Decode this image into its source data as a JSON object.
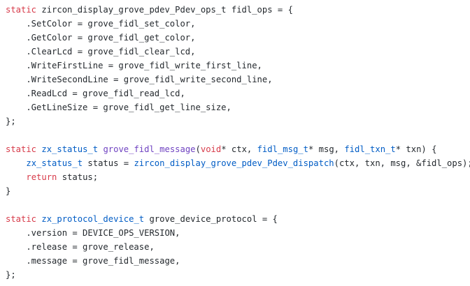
{
  "editor": {
    "colors": {
      "keyword": "#d73a49",
      "type": "#005cc5",
      "function": "#6f42c1",
      "text": "#24292e",
      "background": "#ffffff"
    },
    "lines": [
      [
        {
          "t": "static",
          "c": "kw"
        },
        {
          "t": " zircon_display_grove_pdev_Pdev_ops_t fidl_ops = {",
          "c": "plain"
        }
      ],
      [
        {
          "t": "    .SetColor = grove_fidl_set_color,",
          "c": "plain"
        }
      ],
      [
        {
          "t": "    .GetColor = grove_fidl_get_color,",
          "c": "plain"
        }
      ],
      [
        {
          "t": "    .ClearLcd = grove_fidl_clear_lcd,",
          "c": "plain"
        }
      ],
      [
        {
          "t": "    .WriteFirstLine = grove_fidl_write_first_line,",
          "c": "plain"
        }
      ],
      [
        {
          "t": "    .WriteSecondLine = grove_fidl_write_second_line,",
          "c": "plain"
        }
      ],
      [
        {
          "t": "    .ReadLcd = grove_fidl_read_lcd,",
          "c": "plain"
        }
      ],
      [
        {
          "t": "    .GetLineSize = grove_fidl_get_line_size,",
          "c": "plain"
        }
      ],
      [
        {
          "t": "};",
          "c": "plain"
        }
      ],
      [],
      [
        {
          "t": "static",
          "c": "kw"
        },
        {
          "t": " ",
          "c": "plain"
        },
        {
          "t": "zx_status_t",
          "c": "type"
        },
        {
          "t": " ",
          "c": "plain"
        },
        {
          "t": "grove_fidl_message",
          "c": "fn"
        },
        {
          "t": "(",
          "c": "plain"
        },
        {
          "t": "void",
          "c": "kw"
        },
        {
          "t": "* ctx, ",
          "c": "plain"
        },
        {
          "t": "fidl_msg_t",
          "c": "type"
        },
        {
          "t": "* msg, ",
          "c": "plain"
        },
        {
          "t": "fidl_txn_t",
          "c": "type"
        },
        {
          "t": "* txn) {",
          "c": "plain"
        }
      ],
      [
        {
          "t": "    ",
          "c": "plain"
        },
        {
          "t": "zx_status_t",
          "c": "type"
        },
        {
          "t": " status = ",
          "c": "plain"
        },
        {
          "t": "zircon_display_grove_pdev_Pdev_dispatch",
          "c": "type"
        },
        {
          "t": "(ctx, txn, msg, &fidl_ops);",
          "c": "plain"
        }
      ],
      [
        {
          "t": "    ",
          "c": "plain"
        },
        {
          "t": "return",
          "c": "kw"
        },
        {
          "t": " status;",
          "c": "plain"
        }
      ],
      [
        {
          "t": "}",
          "c": "plain"
        }
      ],
      [],
      [
        {
          "t": "static",
          "c": "kw"
        },
        {
          "t": " ",
          "c": "plain"
        },
        {
          "t": "zx_protocol_device_t",
          "c": "type"
        },
        {
          "t": " grove_device_protocol = {",
          "c": "plain"
        }
      ],
      [
        {
          "t": "    .version = DEVICE_OPS_VERSION,",
          "c": "plain"
        }
      ],
      [
        {
          "t": "    .release = grove_release,",
          "c": "plain"
        }
      ],
      [
        {
          "t": "    .message = grove_fidl_message,",
          "c": "plain"
        }
      ],
      [
        {
          "t": "};",
          "c": "plain"
        }
      ]
    ]
  }
}
